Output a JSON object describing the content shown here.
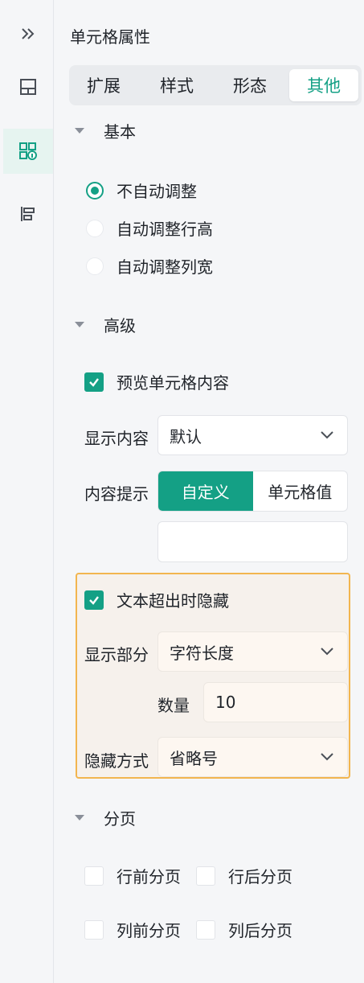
{
  "rail": {
    "items": [
      "expand-icon",
      "layout-icon",
      "cell-info-icon",
      "align-icon"
    ]
  },
  "panel": {
    "title": "单元格属性",
    "tabs": [
      "扩展",
      "样式",
      "形态",
      "其他"
    ],
    "active_tab": "其他",
    "basic": {
      "heading": "基本",
      "options": [
        "不自动调整",
        "自动调整行高",
        "自动调整列宽"
      ],
      "selected": "不自动调整"
    },
    "advanced": {
      "heading": "高级",
      "preview_label": "预览单元格内容",
      "display_label": "显示内容",
      "display_value": "默认",
      "tip_label": "内容提示",
      "tip_options": [
        "自定义",
        "单元格值"
      ],
      "tip_value": "",
      "overflow": {
        "label": "文本超出时隐藏",
        "part_label": "显示部分",
        "part_value": "字符长度",
        "count_label": "数量",
        "count_value": "10",
        "mode_label": "隐藏方式",
        "mode_value": "省略号"
      }
    },
    "paging": {
      "heading": "分页",
      "options": [
        "行前分页",
        "行后分页",
        "列前分页",
        "列后分页"
      ]
    }
  },
  "colors": {
    "accent": "#14a085",
    "highlight_border": "#f2b54f"
  }
}
